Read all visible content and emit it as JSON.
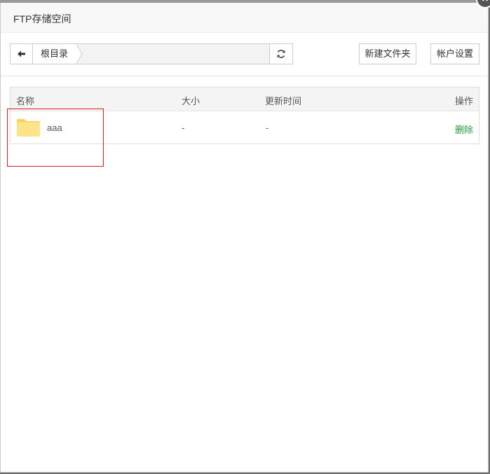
{
  "dialog": {
    "title": "FTP存储空间",
    "close_symbol": "×"
  },
  "toolbar": {
    "breadcrumb_root": "根目录",
    "new_folder_label": "新建文件夹",
    "account_settings_label": "帐户设置",
    "icons": {
      "back": "arrow-left-icon",
      "refresh": "refresh-icon"
    }
  },
  "table": {
    "columns": {
      "name": "名称",
      "size": "大小",
      "updated": "更新时间",
      "action": "操作"
    },
    "rows": [
      {
        "name": "aaa",
        "size": "-",
        "updated": "-",
        "action": "删除",
        "icon": "folder-icon"
      }
    ]
  },
  "colors": {
    "delete_link": "#20a53a",
    "folder": "#fde48a",
    "highlight_border": "#e02020"
  }
}
